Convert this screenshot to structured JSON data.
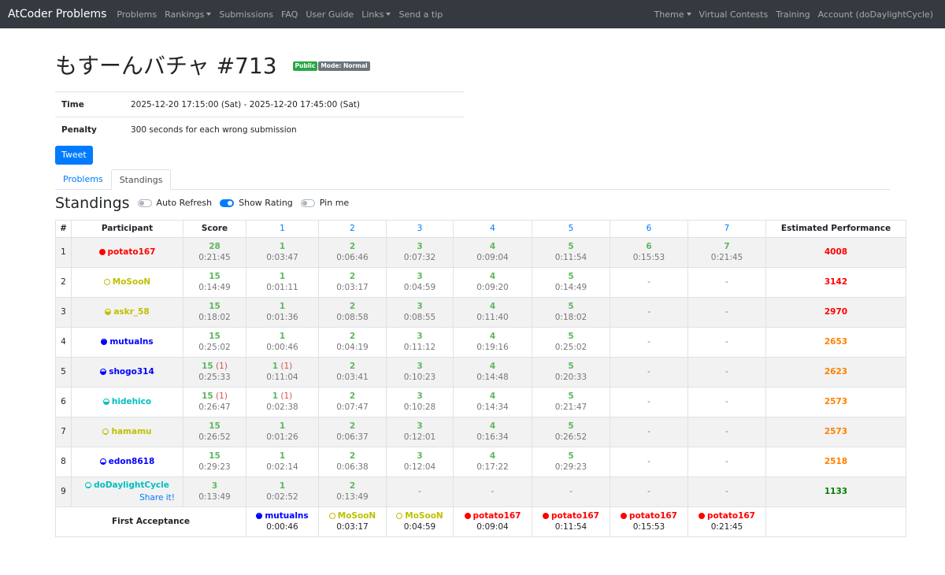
{
  "navbar": {
    "brand": "AtCoder Problems",
    "left_items": [
      {
        "label": "Problems",
        "dropdown": false
      },
      {
        "label": "Rankings",
        "dropdown": true
      },
      {
        "label": "Submissions",
        "dropdown": false
      },
      {
        "label": "FAQ",
        "dropdown": false
      },
      {
        "label": "User Guide",
        "dropdown": false
      },
      {
        "label": "Links",
        "dropdown": true
      },
      {
        "label": "Send a tip",
        "dropdown": false
      }
    ],
    "right_items": [
      {
        "label": "Theme",
        "dropdown": true
      },
      {
        "label": "Virtual Contests",
        "dropdown": false
      },
      {
        "label": "Training",
        "dropdown": false
      },
      {
        "label": "Account (doDaylightCycle)",
        "dropdown": false
      }
    ]
  },
  "contest": {
    "title": "もすーんバチャ #713",
    "badge_public": "Public",
    "badge_mode": "Mode: Normal",
    "time_label": "Time",
    "time_value": "2025-12-20 17:15:00 (Sat) - 2025-12-20 17:45:00 (Sat)",
    "penalty_label": "Penalty",
    "penalty_value": "300 seconds for each wrong submission",
    "tweet_label": "Tweet"
  },
  "tabs": [
    {
      "label": "Problems",
      "active": false
    },
    {
      "label": "Standings",
      "active": true
    }
  ],
  "standings": {
    "title": "Standings",
    "toggles": [
      {
        "label": "Auto Refresh",
        "on": false
      },
      {
        "label": "Show Rating",
        "on": true
      },
      {
        "label": "Pin me",
        "on": false
      }
    ],
    "headers": {
      "rank": "#",
      "participant": "Participant",
      "score": "Score",
      "perf": "Estimated Performance"
    },
    "problems": [
      "1",
      "2",
      "3",
      "4",
      "5",
      "6",
      "7"
    ],
    "share_label": "Share it!",
    "rows": [
      {
        "rank": "1",
        "name": "potato167",
        "color": "red",
        "fill": 1.0,
        "score": "28",
        "penalty": "",
        "time": "0:21:45",
        "perf": "4008",
        "perf_color": "red",
        "cells": [
          {
            "s": "1",
            "p": "",
            "t": "0:03:47"
          },
          {
            "s": "2",
            "p": "",
            "t": "0:06:46"
          },
          {
            "s": "3",
            "p": "",
            "t": "0:07:32"
          },
          {
            "s": "4",
            "p": "",
            "t": "0:09:04"
          },
          {
            "s": "5",
            "p": "",
            "t": "0:11:54"
          },
          {
            "s": "6",
            "p": "",
            "t": "0:15:53"
          },
          {
            "s": "7",
            "p": "",
            "t": "0:21:45"
          }
        ]
      },
      {
        "rank": "2",
        "name": "MoSooN",
        "color": "yellow",
        "fill": 0.0,
        "score": "15",
        "penalty": "",
        "time": "0:14:49",
        "perf": "3142",
        "perf_color": "red",
        "cells": [
          {
            "s": "1",
            "p": "",
            "t": "0:01:11"
          },
          {
            "s": "2",
            "p": "",
            "t": "0:03:17"
          },
          {
            "s": "3",
            "p": "",
            "t": "0:04:59"
          },
          {
            "s": "4",
            "p": "",
            "t": "0:09:20"
          },
          {
            "s": "5",
            "p": "",
            "t": "0:14:49"
          },
          {
            "s": "-"
          },
          {
            "s": "-"
          }
        ]
      },
      {
        "rank": "3",
        "name": "askr_58",
        "color": "yellow",
        "fill": 0.6,
        "score": "15",
        "penalty": "",
        "time": "0:18:02",
        "perf": "2970",
        "perf_color": "red",
        "cells": [
          {
            "s": "1",
            "p": "",
            "t": "0:01:36"
          },
          {
            "s": "2",
            "p": "",
            "t": "0:08:58"
          },
          {
            "s": "3",
            "p": "",
            "t": "0:08:55"
          },
          {
            "s": "4",
            "p": "",
            "t": "0:11:40"
          },
          {
            "s": "5",
            "p": "",
            "t": "0:18:02"
          },
          {
            "s": "-"
          },
          {
            "s": "-"
          }
        ]
      },
      {
        "rank": "4",
        "name": "mutualns",
        "color": "blue",
        "fill": 0.9,
        "score": "15",
        "penalty": "",
        "time": "0:25:02",
        "perf": "2653",
        "perf_color": "orange",
        "cells": [
          {
            "s": "1",
            "p": "",
            "t": "0:00:46"
          },
          {
            "s": "2",
            "p": "",
            "t": "0:04:19"
          },
          {
            "s": "3",
            "p": "",
            "t": "0:11:12"
          },
          {
            "s": "4",
            "p": "",
            "t": "0:19:16"
          },
          {
            "s": "5",
            "p": "",
            "t": "0:25:02"
          },
          {
            "s": "-"
          },
          {
            "s": "-"
          }
        ]
      },
      {
        "rank": "5",
        "name": "shogo314",
        "color": "blue",
        "fill": 0.6,
        "score": "15",
        "penalty": "(1)",
        "time": "0:25:33",
        "perf": "2623",
        "perf_color": "orange",
        "cells": [
          {
            "s": "1",
            "p": "(1)",
            "t": "0:11:04"
          },
          {
            "s": "2",
            "p": "",
            "t": "0:03:41"
          },
          {
            "s": "3",
            "p": "",
            "t": "0:10:23"
          },
          {
            "s": "4",
            "p": "",
            "t": "0:14:48"
          },
          {
            "s": "5",
            "p": "",
            "t": "0:20:33"
          },
          {
            "s": "-"
          },
          {
            "s": "-"
          }
        ]
      },
      {
        "rank": "6",
        "name": "hidehico",
        "color": "cyan",
        "fill": 0.5,
        "score": "15",
        "penalty": "(1)",
        "time": "0:26:47",
        "perf": "2573",
        "perf_color": "orange",
        "cells": [
          {
            "s": "1",
            "p": "(1)",
            "t": "0:02:38"
          },
          {
            "s": "2",
            "p": "",
            "t": "0:07:47"
          },
          {
            "s": "3",
            "p": "",
            "t": "0:10:28"
          },
          {
            "s": "4",
            "p": "",
            "t": "0:14:34"
          },
          {
            "s": "5",
            "p": "",
            "t": "0:21:47"
          },
          {
            "s": "-"
          },
          {
            "s": "-"
          }
        ]
      },
      {
        "rank": "7",
        "name": "hamamu",
        "color": "yellow",
        "fill": 0.2,
        "score": "15",
        "penalty": "",
        "time": "0:26:52",
        "perf": "2573",
        "perf_color": "orange",
        "cells": [
          {
            "s": "1",
            "p": "",
            "t": "0:01:26"
          },
          {
            "s": "2",
            "p": "",
            "t": "0:06:37"
          },
          {
            "s": "3",
            "p": "",
            "t": "0:12:01"
          },
          {
            "s": "4",
            "p": "",
            "t": "0:16:34"
          },
          {
            "s": "5",
            "p": "",
            "t": "0:26:52"
          },
          {
            "s": "-"
          },
          {
            "s": "-"
          }
        ]
      },
      {
        "rank": "8",
        "name": "edon8618",
        "color": "blue",
        "fill": 0.3,
        "score": "15",
        "penalty": "",
        "time": "0:29:23",
        "perf": "2518",
        "perf_color": "orange",
        "cells": [
          {
            "s": "1",
            "p": "",
            "t": "0:02:14"
          },
          {
            "s": "2",
            "p": "",
            "t": "0:06:38"
          },
          {
            "s": "3",
            "p": "",
            "t": "0:12:04"
          },
          {
            "s": "4",
            "p": "",
            "t": "0:17:22"
          },
          {
            "s": "5",
            "p": "",
            "t": "0:29:23"
          },
          {
            "s": "-"
          },
          {
            "s": "-"
          }
        ]
      },
      {
        "rank": "9",
        "name": "doDaylightCycle",
        "color": "cyan",
        "fill": 0.2,
        "score": "3",
        "penalty": "",
        "time": "0:13:49",
        "perf": "1133",
        "perf_color": "green",
        "share": true,
        "cells": [
          {
            "s": "1",
            "p": "",
            "t": "0:02:52"
          },
          {
            "s": "2",
            "p": "",
            "t": "0:13:49"
          },
          {
            "s": "-"
          },
          {
            "s": "-"
          },
          {
            "s": "-"
          },
          {
            "s": "-"
          },
          {
            "s": "-"
          }
        ]
      }
    ],
    "first_acceptance": {
      "label": "First Acceptance",
      "cells": [
        {
          "name": "mutualns",
          "color": "blue",
          "fill": 0.9,
          "time": "0:00:46"
        },
        {
          "name": "MoSooN",
          "color": "yellow",
          "fill": 0.0,
          "time": "0:03:17"
        },
        {
          "name": "MoSooN",
          "color": "yellow",
          "fill": 0.0,
          "time": "0:04:59"
        },
        {
          "name": "potato167",
          "color": "red",
          "fill": 1.0,
          "time": "0:09:04"
        },
        {
          "name": "potato167",
          "color": "red",
          "fill": 1.0,
          "time": "0:11:54"
        },
        {
          "name": "potato167",
          "color": "red",
          "fill": 1.0,
          "time": "0:15:53"
        },
        {
          "name": "potato167",
          "color": "red",
          "fill": 1.0,
          "time": "0:21:45"
        }
      ]
    }
  },
  "colors": {
    "red": "#ff0000",
    "yellow": "#c0c000",
    "blue": "#0000ff",
    "cyan": "#00c0c0",
    "orange": "#ff8000",
    "green": "#008000",
    "accent": "#007bff",
    "ac": "#5cb85c"
  }
}
